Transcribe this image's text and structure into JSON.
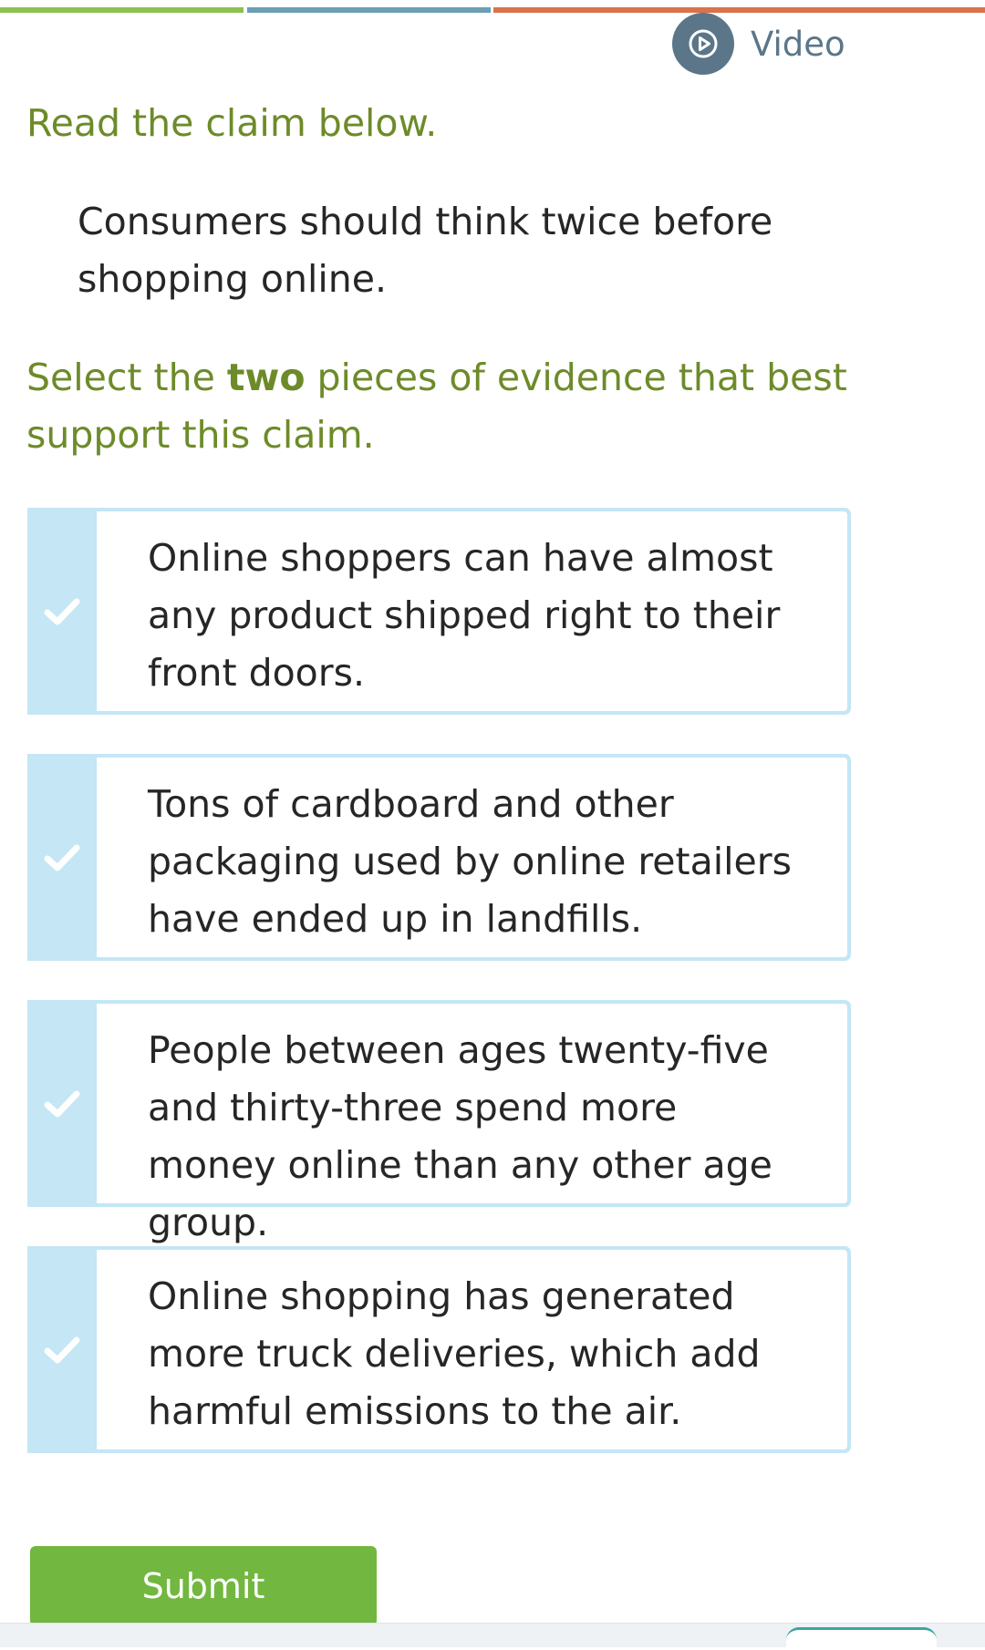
{
  "colors": {
    "strip": [
      "#8cc152",
      "#6a9fb5",
      "#d9734a"
    ],
    "instruction_text": "#6d8b29",
    "video_icon_bg": "#5b7689",
    "choice_border": "#c4e6f5",
    "choice_check_bg": "#c4e6f5",
    "submit_bg": "#72b73f"
  },
  "header": {
    "video_label": "Video",
    "video_icon": "play-icon"
  },
  "question": {
    "instruction_1": "Read the claim below.",
    "claim": "Consumers should think twice before shopping online.",
    "instruction_2_before": "Select the ",
    "instruction_2_emphasis": "two",
    "instruction_2_after": " pieces of evidence that best support this claim."
  },
  "choices": [
    {
      "text": "Online shoppers can have almost any product shipped right to their front doors.",
      "icon": "checkmark-icon"
    },
    {
      "text": "Tons of cardboard and other packaging used by online retailers have ended up in landfills.",
      "icon": "checkmark-icon"
    },
    {
      "text": "People between ages twenty-five and thirty-three spend more money online than any other age group.",
      "icon": "checkmark-icon"
    },
    {
      "text": "Online shopping has generated more truck deliveries, which add harmful emissions to the air.",
      "icon": "checkmark-icon"
    }
  ],
  "actions": {
    "submit_label": "Submit"
  }
}
